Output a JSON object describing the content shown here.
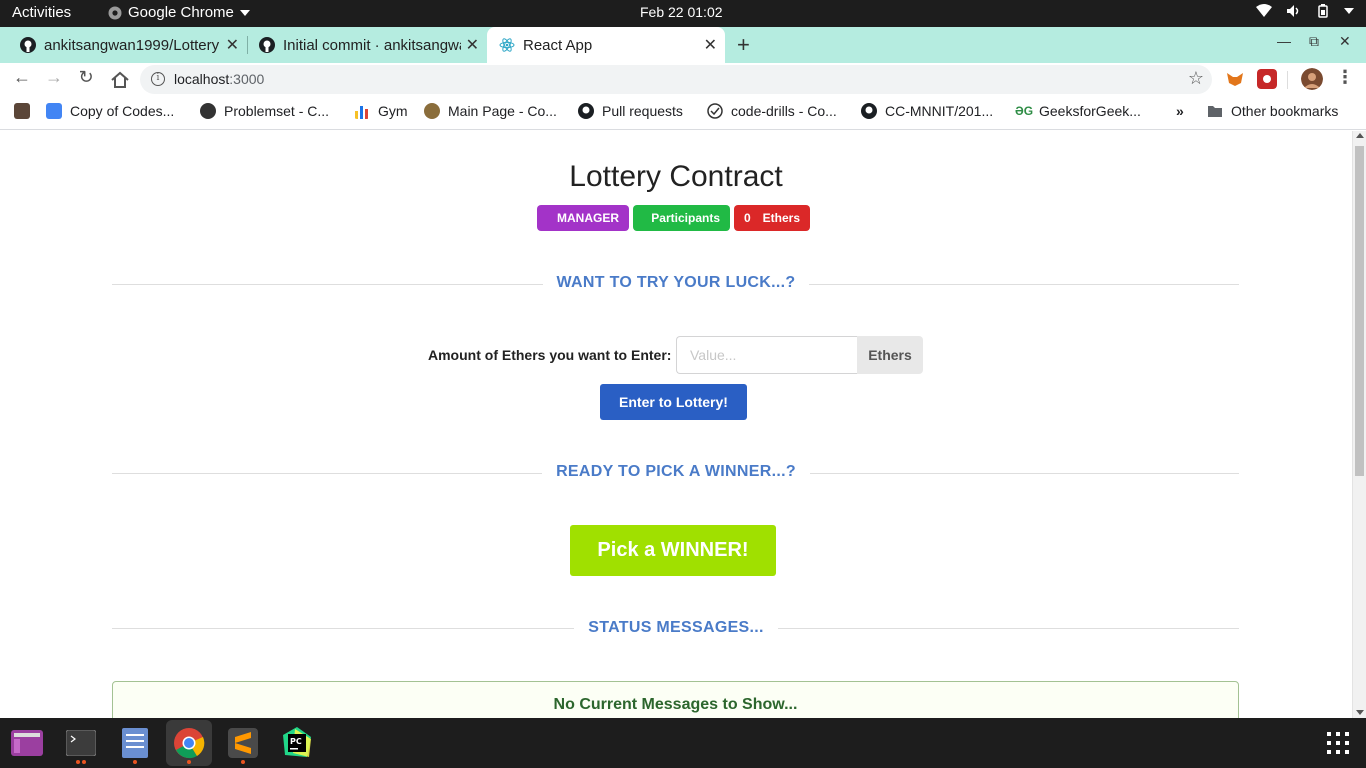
{
  "system_bar": {
    "activities": "Activities",
    "app_name": "Google Chrome",
    "clock": "Feb 22  01:02"
  },
  "browser": {
    "tabs": [
      {
        "title": "ankitsangwan1999/Lottery",
        "icon": "github-icon",
        "active": false
      },
      {
        "title": "Initial commit · ankitsangwan",
        "icon": "github-icon",
        "active": false
      },
      {
        "title": "React App",
        "icon": "react-icon",
        "active": true
      }
    ],
    "url_host": "localhost",
    "url_port": ":3000",
    "bookmarks": [
      {
        "label": "",
        "icon": "codechef-icon"
      },
      {
        "label": "Copy of Codes...",
        "icon": "docs-icon"
      },
      {
        "label": "Problemset - C...",
        "icon": "globe-icon"
      },
      {
        "label": "Gym",
        "icon": "chart-icon"
      },
      {
        "label": "Main Page - Co...",
        "icon": "owl-icon"
      },
      {
        "label": "Pull requests",
        "icon": "github-icon"
      },
      {
        "label": "code-drills - Co...",
        "icon": "check-icon"
      },
      {
        "label": "CC-MNNIT/201...",
        "icon": "github-icon"
      },
      {
        "label": "GeeksforGeek...",
        "icon": "gfg-icon"
      }
    ],
    "bookmarks_overflow": "»",
    "other_bookmarks": "Other bookmarks"
  },
  "page": {
    "title": "Lottery Contract",
    "labels": {
      "manager": {
        "value": "",
        "text": "MANAGER",
        "color": "#a333c8"
      },
      "participants": {
        "value": "",
        "text": "Participants",
        "color": "#21ba45"
      },
      "ethers": {
        "value": "0",
        "text": "Ethers",
        "color": "#db2828"
      }
    },
    "section_try": "WANT TO TRY YOUR LUCK...?",
    "amount_label": "Amount of Ethers you want to Enter:",
    "amount_placeholder": "Value...",
    "amount_value": "",
    "amount_suffix": "Ethers",
    "enter_button": "Enter to Lottery!",
    "section_pick": "READY TO PICK A WINNER...?",
    "pick_button": "Pick a WINNER!",
    "section_status": "STATUS MESSAGES...",
    "status_message": "No Current Messages to Show..."
  },
  "dock": {
    "apps": [
      "screenshot-app-icon",
      "terminal-icon",
      "files-icon",
      "chrome-icon",
      "sublime-text-icon",
      "pycharm-icon"
    ]
  },
  "colors": {
    "tab_strip": "#b5ece0",
    "divider_text": "#4a7bc8",
    "enter_button": "#2a5fc4",
    "pick_button": "#a0e000"
  }
}
